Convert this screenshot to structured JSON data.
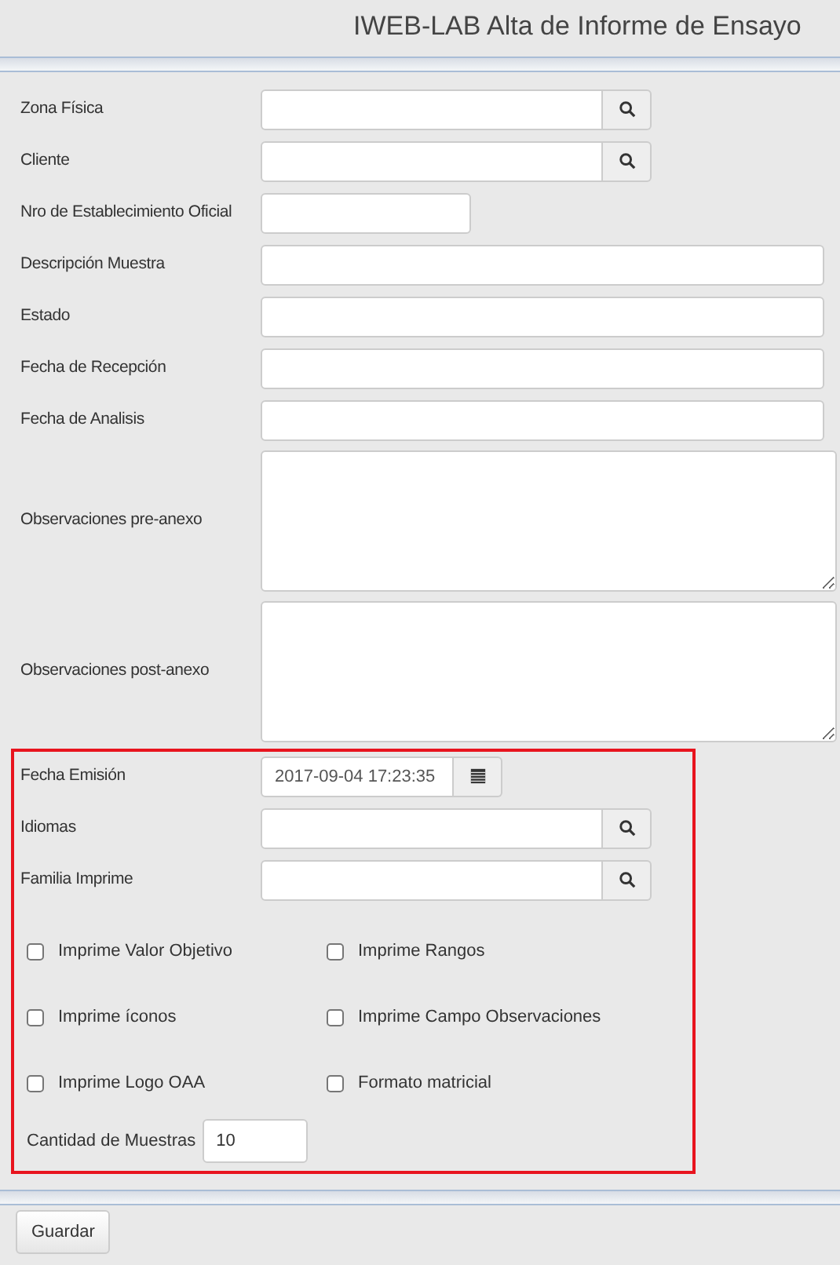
{
  "header": {
    "title": "IWEB-LAB Alta de Informe de Ensayo"
  },
  "fields": [
    {
      "kind": "lookup",
      "label": "Zona Física"
    },
    {
      "kind": "lookup",
      "label": "Cliente"
    },
    {
      "kind": "short",
      "label": "Nro de Establecimiento Oficial"
    },
    {
      "kind": "text",
      "label": "Descripción Muestra"
    },
    {
      "kind": "text",
      "label": "Estado"
    },
    {
      "kind": "text",
      "label": "Fecha de Recepción"
    },
    {
      "kind": "text",
      "label": "Fecha de Analisis"
    },
    {
      "kind": "textarea",
      "label": "Observaciones pre-anexo"
    },
    {
      "kind": "textarea",
      "label": "Observaciones post-anexo"
    }
  ],
  "highlighted_section": {
    "fields": [
      {
        "kind": "date",
        "label": "Fecha Emisión",
        "value": "2017-09-04 17:23:35"
      },
      {
        "kind": "lookup",
        "label": "Idiomas"
      },
      {
        "kind": "lookup",
        "label": "Familia Imprime"
      }
    ],
    "checkboxes": [
      {
        "label": "Imprime Valor Objetivo",
        "checked": false
      },
      {
        "label": "Imprime Rangos",
        "checked": false
      },
      {
        "label": "Imprime íconos",
        "checked": false
      },
      {
        "label": "Imprime Campo Observaciones",
        "checked": false
      },
      {
        "label": "Imprime Logo OAA",
        "checked": false
      },
      {
        "label": "Formato matricial",
        "checked": false
      }
    ],
    "sample_count": {
      "label": "Cantidad de Muestras",
      "value": "10"
    }
  },
  "buttons": [
    "Guardar"
  ]
}
